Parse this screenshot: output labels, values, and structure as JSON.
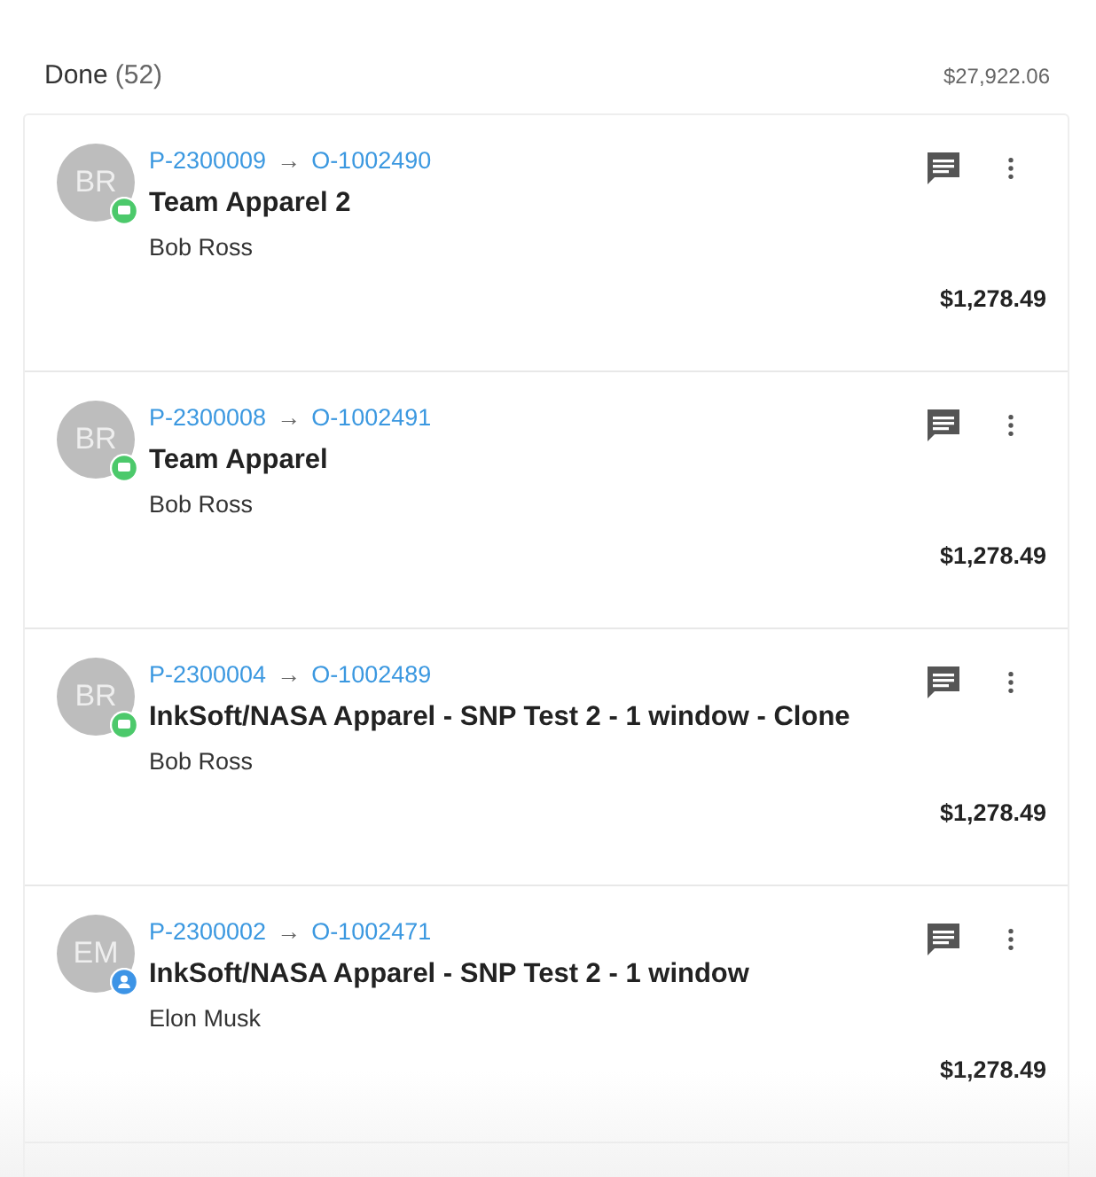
{
  "section": {
    "title": "Done",
    "count": "(52)",
    "total": "$27,922.06"
  },
  "orders": [
    {
      "initials": "BR",
      "kind": "chat",
      "proposal": "P-2300009",
      "arrow": "→",
      "order": "O-1002490",
      "title": "Team Apparel 2",
      "customer": "Bob Ross",
      "amount": "$1,278.49"
    },
    {
      "initials": "BR",
      "kind": "chat",
      "proposal": "P-2300008",
      "arrow": "→",
      "order": "O-1002491",
      "title": "Team Apparel",
      "customer": "Bob Ross",
      "amount": "$1,278.49"
    },
    {
      "initials": "BR",
      "kind": "chat",
      "proposal": "P-2300004",
      "arrow": "→",
      "order": "O-1002489",
      "title": "InkSoft/NASA Apparel - SNP Test 2 - 1 window - Clone",
      "customer": "Bob Ross",
      "amount": "$1,278.49"
    },
    {
      "initials": "EM",
      "kind": "person",
      "proposal": "P-2300002",
      "arrow": "→",
      "order": "O-1002471",
      "title": "InkSoft/NASA Apparel - SNP Test 2 - 1 window",
      "customer": "Elon Musk",
      "amount": "$1,278.49"
    }
  ]
}
